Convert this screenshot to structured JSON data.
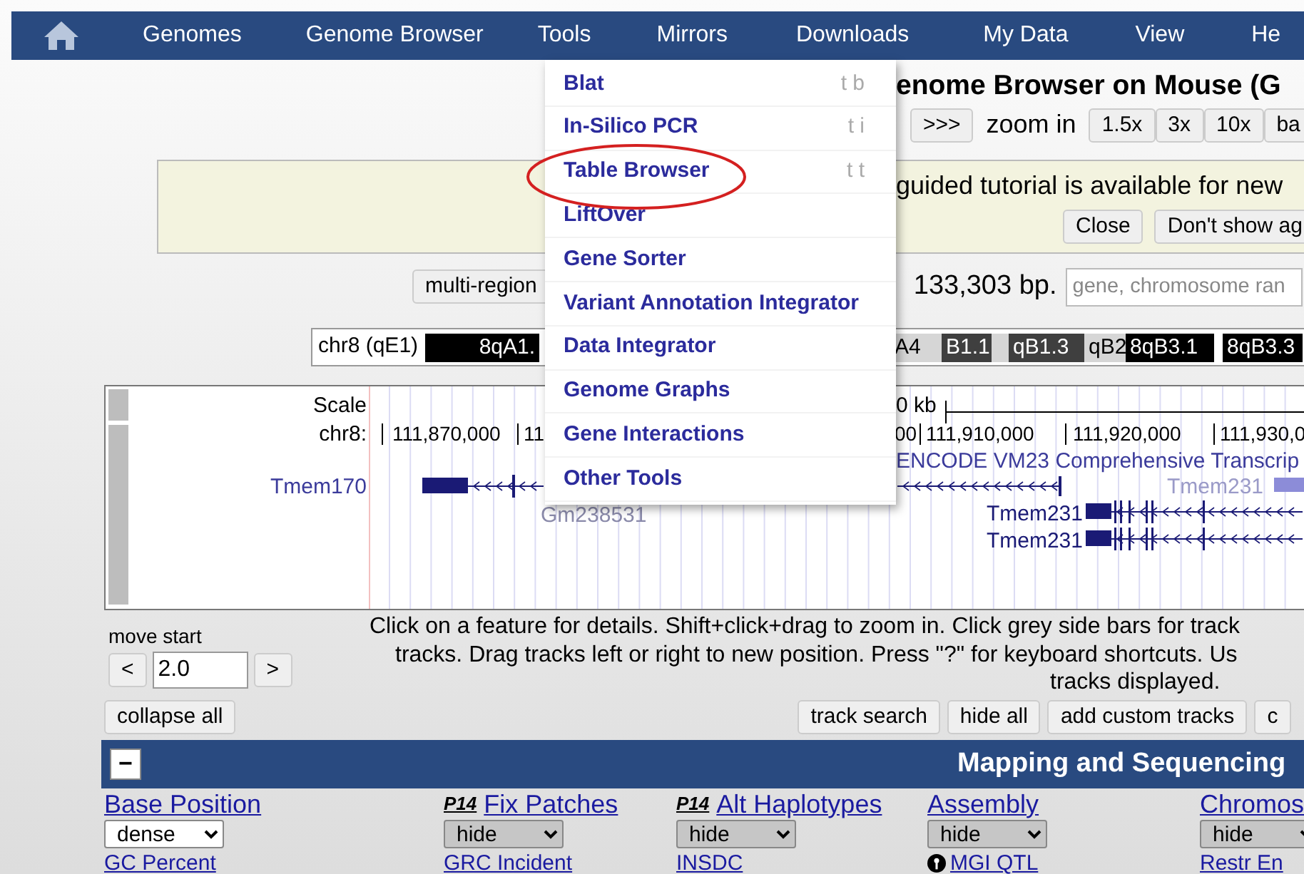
{
  "nav": {
    "items": [
      "Genomes",
      "Genome Browser",
      "Tools",
      "Mirrors",
      "Downloads",
      "My Data",
      "View",
      "He"
    ]
  },
  "tools_menu": [
    {
      "label": "Blat",
      "shortcut": "t b",
      "circled": false
    },
    {
      "label": "In-Silico PCR",
      "shortcut": "t i",
      "circled": false
    },
    {
      "label": "Table Browser",
      "shortcut": "t t",
      "circled": true
    },
    {
      "label": "LiftOver",
      "circled": false
    },
    {
      "label": "Gene Sorter",
      "circled": false
    },
    {
      "label": "Variant Annotation Integrator",
      "circled": false
    },
    {
      "label": "Data Integrator",
      "circled": false
    },
    {
      "label": "Genome Graphs",
      "circled": false
    },
    {
      "label": "Gene Interactions",
      "circled": false
    },
    {
      "label": "Other Tools",
      "circled": false
    }
  ],
  "title": "enome Browser on Mouse (G",
  "zoom": {
    "out_buttons": [
      ">>>"
    ],
    "label": "zoom in",
    "in_buttons": [
      "1.5x",
      "3x",
      "10x",
      "ba"
    ]
  },
  "tutorial": {
    "text": "guided tutorial is available for new",
    "buttons": [
      "Close",
      "Don't show ag"
    ]
  },
  "position": {
    "multi_region_button": "multi-region",
    "size": "133,303 bp.",
    "search_placeholder": "gene, chromosome ran"
  },
  "ideogram": {
    "label": "chr8 (qE1)",
    "bands": [
      {
        "label": "8qA1.",
        "color": "#000000"
      },
      {
        "label": "A4",
        "color": "#d6d6d6"
      },
      {
        "label": "B1.1",
        "color": "#3f3f3f"
      },
      {
        "color": "#d6d6d6"
      },
      {
        "label": "qB1.3",
        "color": "#3f3f3f"
      },
      {
        "label": "qB2",
        "color": "#d6d6d6"
      },
      {
        "label": "8qB3.1",
        "color": "#000000"
      },
      {
        "label": "8qB3.3",
        "color": "#000000"
      }
    ]
  },
  "track_image": {
    "scale_label": "Scale",
    "chrom_label": "chr8:",
    "scale_text": "0 kb",
    "ruler": [
      "111,870,000",
      "11",
      "00",
      "111,910,000",
      "111,920,000",
      "111,930,0"
    ],
    "track_title": "ENCODE VM23 Comprehensive Transcrip",
    "genes": [
      {
        "name": "Tmem170",
        "kind": "left-label"
      },
      {
        "name": "Gm238531",
        "kind": "below"
      },
      {
        "name": "Tmem231",
        "kind": "faded"
      },
      {
        "name": "Tmem231",
        "kind": "inline"
      },
      {
        "name": "Tmem231",
        "kind": "inline"
      }
    ]
  },
  "move": {
    "label": "move start",
    "left_button": "<",
    "value": "2.0",
    "right_button": ">"
  },
  "instructions": [
    "Click on a feature for details. Shift+click+drag to zoom in. Click grey side bars for track",
    "tracks. Drag tracks left or right to new position. Press \"?\" for keyboard shortcuts. Us",
    "tracks displayed."
  ],
  "buttons": {
    "left": [
      "collapse all"
    ],
    "right": [
      "track search",
      "hide all",
      "add custom tracks",
      "c"
    ]
  },
  "section": {
    "collapse_button": "−",
    "title": "Mapping and Sequencing"
  },
  "tracks": [
    {
      "label": "Base Position",
      "mode": "dense"
    },
    {
      "prefix": "P14",
      "label": "Fix Patches",
      "mode": "hide"
    },
    {
      "prefix": "P14",
      "label": "Alt Haplotypes",
      "mode": "hide"
    },
    {
      "label": "Assembly",
      "mode": "hide"
    },
    {
      "label": "Chromos",
      "mode": "hide"
    },
    {
      "label": "GC Percent"
    },
    {
      "label": "GRC Incident"
    },
    {
      "label": "INSDC"
    },
    {
      "label": "MGI QTL",
      "icon": true
    },
    {
      "label": "Restr En"
    }
  ]
}
